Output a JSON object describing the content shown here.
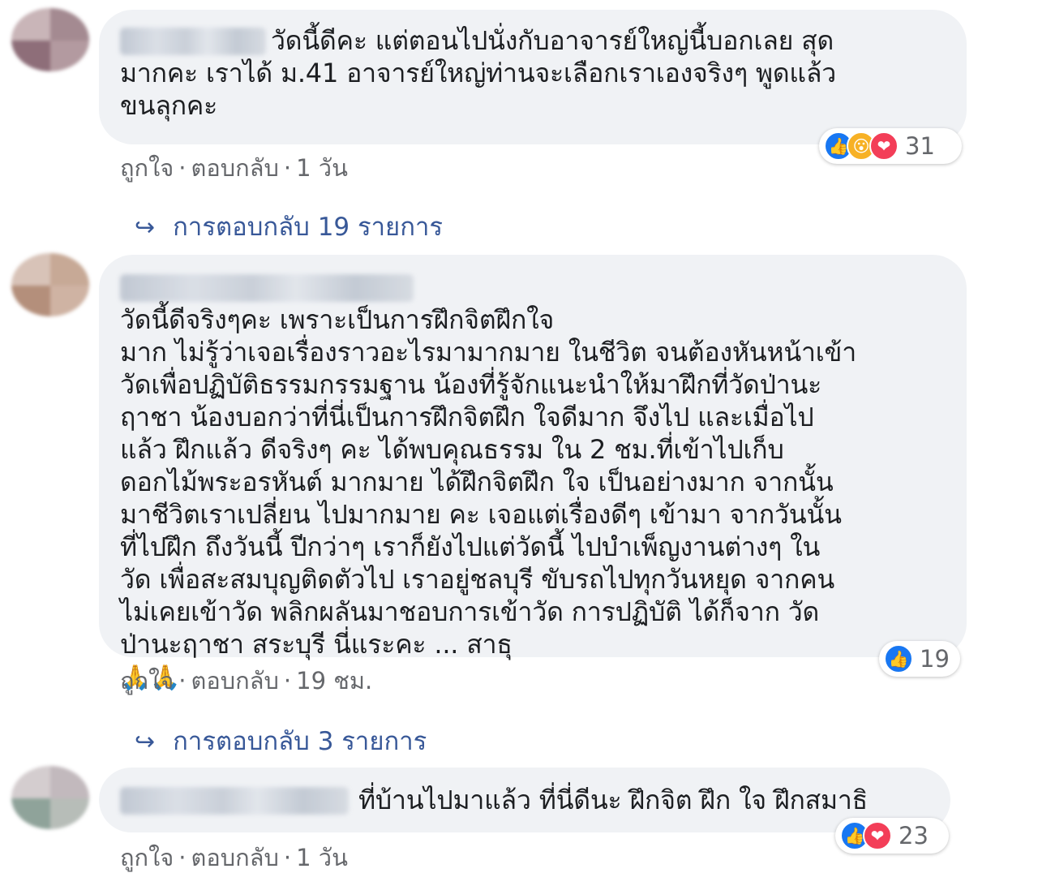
{
  "comments": [
    {
      "text": "วัดนี้ดีคะ แต่ตอนไปนั่งกับอาจารย์ใหญ่นี้บอกเลย สุด\nมากคะ เราได้ ม.41 อาจารย์ใหญ่ท่านจะเลือกเราเองจริงๆ พูดแล้ว\nขนลุกคะ",
      "like_label": "ถูกใจ",
      "reply_label": "ตอบกลับ",
      "time": "1 วัน",
      "reaction_count": "31",
      "reactions": [
        "like-icon",
        "wow-icon",
        "love-icon"
      ],
      "replies_label": "การตอบกลับ 19 รายการ"
    },
    {
      "text_main": "วัดนี้ดีจริงๆคะ เพราะเป็นการฝึกจิตฝึกใจ\nมาก ไม่รู้ว่าเจอเรื่องราวอะไรมามากมาย ในชีวิต จนต้องหันหน้าเข้า\nวัดเพื่อปฏิบัติธรรมกรรมฐาน น้องที่รู้จักแนะนำให้มาฝึกที่วัดป่านะ\nฤาชา น้องบอกว่าที่นี่เป็นการฝึกจิตฝึก ใจดีมาก จึงไป และเมื่อไป\nแล้ว ฝึกแล้ว ดีจริงๆ คะ ได้พบคุณธรรม ใน 2 ชม.ที่เข้าไปเก็บ\nดอกไม้พระอรหันต์ มากมาย ได้ฝึกจิตฝึก ใจ เป็นอย่างมาก จากนั้น\nมาชีวิตเราเปลี่ยน ไปมากมาย คะ เจอแต่เรื่องดีๆ เข้ามา จากวันนั้น\nที่ไปฝึก ถึงวันนี้ ปีกว่าๆ เราก็ยังไปแต่วัดนี้ ไปบำเพ็ญงานต่างๆ ใน\nวัด เพื่อสะสมบุญติดตัวไป เราอยู่ชลบุรี ขับรถไปทุกวันหยุด จากคน\nไม่เคยเข้าวัด พลิกผลันมาชอบการเข้าวัด การปฏิบัติ ได้ก็จาก วัด\nป่านะฤาชา สระบุรี นี่แระคะ ... สาธุ",
      "emoji": "🙏🙏",
      "like_label": "ถูกใจ",
      "reply_label": "ตอบกลับ",
      "time": "19 ชม.",
      "reaction_count": "19",
      "reactions": [
        "like-icon"
      ],
      "replies_label": "การตอบกลับ 3 รายการ"
    },
    {
      "text": "ที่บ้านไปมาแล้ว ที่นี่ดีนะ ฝึกจิต ฝึก ใจ ฝึกสมาธิ",
      "like_label": "ถูกใจ",
      "reply_label": "ตอบกลับ",
      "time": "1 วัน",
      "reaction_count": "23",
      "reactions": [
        "like-icon",
        "love-icon"
      ]
    }
  ],
  "separator": "·",
  "colors": {
    "bubble": "#f0f2f5",
    "meta_text": "#65676b",
    "link": "#385898",
    "like": "#1877f2",
    "love": "#f33e58",
    "wow": "#f7b125"
  }
}
